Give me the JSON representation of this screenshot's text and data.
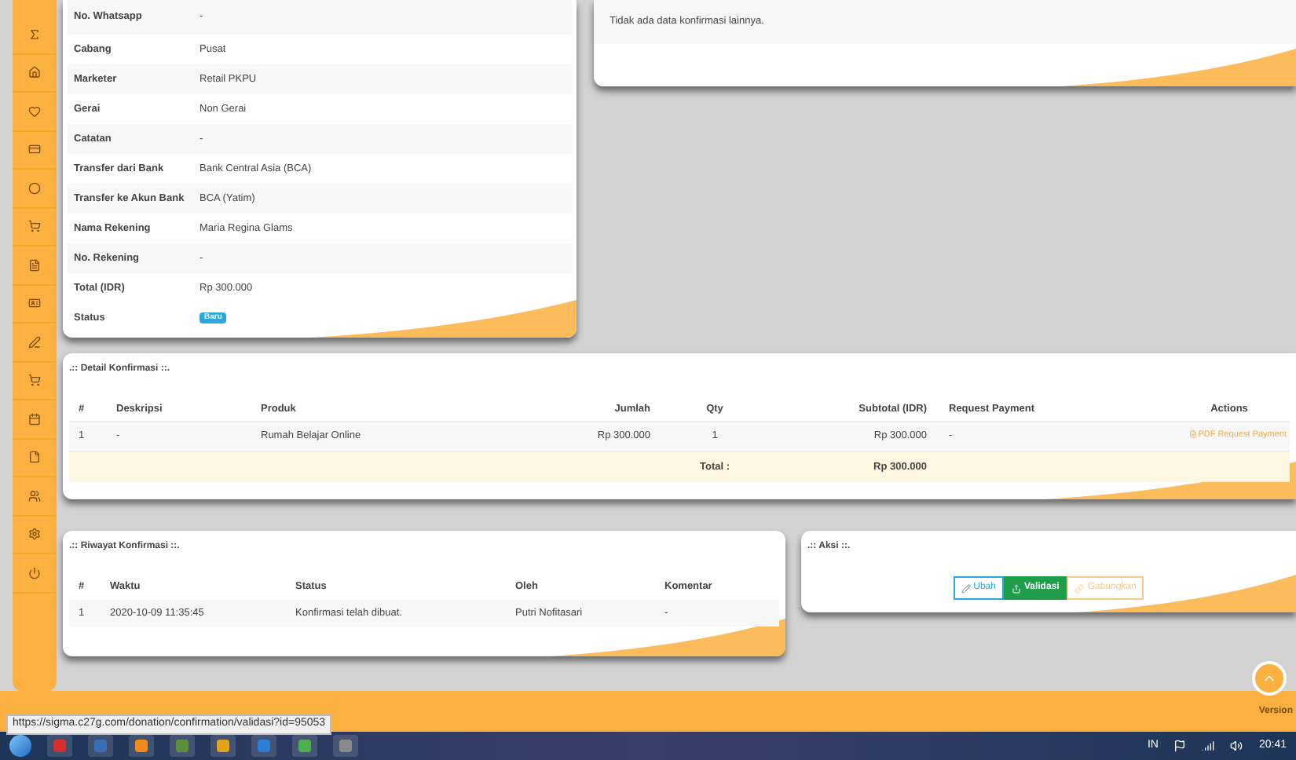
{
  "info_table": {
    "rows": [
      {
        "label": "No. Whatsapp",
        "value": "-"
      },
      {
        "label": "Cabang",
        "value": "Pusat"
      },
      {
        "label": "Marketer",
        "value": "Retail PKPU"
      },
      {
        "label": "Gerai",
        "value": "Non Gerai"
      },
      {
        "label": "Catatan",
        "value": "-"
      },
      {
        "label": "Transfer dari Bank",
        "value": "Bank Central Asia (BCA)"
      },
      {
        "label": "Transfer ke Akun Bank",
        "value": "BCA (Yatim)"
      },
      {
        "label": "Nama Rekening",
        "value": "Maria Regina Glams"
      },
      {
        "label": "No. Rekening",
        "value": "-"
      },
      {
        "label": "Total (IDR)",
        "value": "Rp 300.000"
      }
    ],
    "status": {
      "label": "Status",
      "badge": "Baru"
    }
  },
  "other_confirmations": {
    "message": "Tidak ada data konfirmasi lainnya."
  },
  "detail": {
    "title": ".:: Detail Konfirmasi ::.",
    "columns": [
      "#",
      "Deskripsi",
      "Produk",
      "Jumlah",
      "Qty",
      "Subtotal (IDR)",
      "Request Payment",
      "Actions"
    ],
    "rows": [
      {
        "cells": [
          "1",
          "-",
          "Rumah Belajar Online",
          "Rp 300.000",
          "1",
          "Rp 300.000",
          "-"
        ],
        "action": "PDF Request Payment"
      }
    ],
    "total_label": "Total :",
    "total_value": "Rp 300.000"
  },
  "history": {
    "title": ".:: Riwayat Konfirmasi ::.",
    "columns": [
      "#",
      "Waktu",
      "Status",
      "Oleh",
      "Komentar"
    ],
    "rows": [
      [
        "1",
        "2020-10-09 11:35:45",
        "Konfirmasi telah dibuat.",
        "Putri Nofitasari",
        "-"
      ]
    ]
  },
  "actions_panel": {
    "title": ".:: Aksi ::.",
    "buttons": [
      {
        "label": "Ubah",
        "kind": "edit"
      },
      {
        "label": "Validasi",
        "kind": "validate"
      },
      {
        "label": "Gabungkan",
        "kind": "merge"
      }
    ]
  },
  "footer": {
    "version": "Version"
  },
  "status_url": "https://sigma.c27g.com/donation/confirmation/validasi?id=95053",
  "taskbar": {
    "language": "IN",
    "time": "20:41"
  }
}
